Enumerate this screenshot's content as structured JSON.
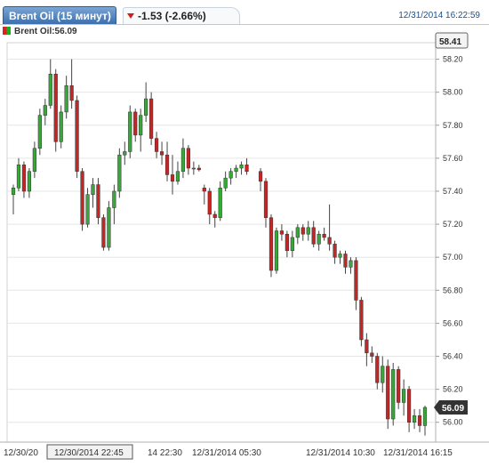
{
  "tab": {
    "title": "Brent Oil (15 минут)"
  },
  "change": {
    "text": "-1.53 (-2.66%)",
    "direction": "down"
  },
  "datetime": "12/31/2014 16:22:59",
  "legend": {
    "label": "Brent Oil:56.09"
  },
  "price_tags": {
    "top": "58.41",
    "last": "56.09"
  },
  "colors": {
    "up": "#33aa33",
    "down": "#cc2222",
    "grid": "#e6e6e6",
    "accent": "#3c6fad"
  },
  "chart_data": {
    "type": "candlestick",
    "title": "Brent Oil (15 минут)",
    "ylim": [
      55.88,
      58.3
    ],
    "y_ticks": [
      "58.20",
      "58.00",
      "57.80",
      "57.60",
      "57.40",
      "57.20",
      "57.00",
      "56.80",
      "56.60",
      "56.40",
      "56.20",
      "56.00"
    ],
    "x_ticks": [
      "12/30/20",
      "12/30/2014 22:45",
      "14 22:30",
      "12/31/2014 05:30",
      "12/31/2014 10:30",
      "12/31/2014 16:15"
    ],
    "x_ticks_highlighted": [
      1
    ],
    "gap_after_index": 44,
    "candles": [
      [
        57.38,
        57.44,
        57.26,
        57.42
      ],
      [
        57.42,
        57.6,
        57.4,
        57.56
      ],
      [
        57.56,
        57.58,
        57.36,
        57.4
      ],
      [
        57.4,
        57.54,
        57.36,
        57.52
      ],
      [
        57.52,
        57.7,
        57.48,
        57.66
      ],
      [
        57.66,
        57.9,
        57.62,
        57.86
      ],
      [
        57.86,
        57.96,
        57.8,
        57.92
      ],
      [
        57.92,
        58.2,
        57.9,
        58.11
      ],
      [
        58.11,
        58.14,
        57.64,
        57.7
      ],
      [
        57.7,
        57.92,
        57.66,
        57.88
      ],
      [
        57.88,
        58.1,
        57.84,
        58.04
      ],
      [
        58.04,
        58.2,
        57.9,
        57.95
      ],
      [
        57.95,
        57.98,
        57.48,
        57.52
      ],
      [
        57.52,
        57.54,
        57.16,
        57.2
      ],
      [
        57.2,
        57.42,
        57.18,
        57.38
      ],
      [
        57.38,
        57.48,
        57.3,
        57.44
      ],
      [
        57.44,
        57.48,
        57.2,
        57.24
      ],
      [
        57.24,
        57.26,
        57.04,
        57.06
      ],
      [
        57.06,
        57.34,
        57.04,
        57.3
      ],
      [
        57.3,
        57.44,
        57.2,
        57.4
      ],
      [
        57.4,
        57.66,
        57.36,
        57.62
      ],
      [
        57.62,
        57.7,
        57.56,
        57.64
      ],
      [
        57.64,
        57.92,
        57.6,
        57.88
      ],
      [
        57.88,
        57.9,
        57.7,
        57.74
      ],
      [
        57.74,
        57.9,
        57.64,
        57.86
      ],
      [
        57.86,
        58.06,
        57.82,
        57.96
      ],
      [
        57.96,
        58.0,
        57.68,
        57.72
      ],
      [
        57.72,
        57.76,
        57.6,
        57.64
      ],
      [
        57.64,
        57.7,
        57.56,
        57.62
      ],
      [
        57.62,
        57.7,
        57.46,
        57.5
      ],
      [
        57.5,
        57.62,
        57.38,
        57.46
      ],
      [
        57.46,
        57.58,
        57.44,
        57.52
      ],
      [
        57.52,
        57.72,
        57.48,
        57.66
      ],
      [
        57.66,
        57.68,
        57.5,
        57.54
      ],
      [
        57.54,
        57.58,
        57.5,
        57.54
      ],
      [
        57.54,
        57.56,
        57.52,
        57.53
      ],
      [
        57.42,
        57.44,
        57.32,
        57.4
      ],
      [
        57.4,
        57.42,
        57.2,
        57.26
      ],
      [
        57.26,
        57.28,
        57.18,
        57.24
      ],
      [
        57.24,
        57.46,
        57.22,
        57.42
      ],
      [
        57.42,
        57.52,
        57.4,
        57.48
      ],
      [
        57.48,
        57.54,
        57.44,
        57.52
      ],
      [
        57.52,
        57.56,
        57.48,
        57.54
      ],
      [
        57.54,
        57.58,
        57.5,
        57.56
      ],
      [
        57.56,
        57.6,
        57.5,
        57.52
      ],
      [
        57.52,
        57.54,
        57.4,
        57.46
      ],
      [
        57.46,
        57.48,
        57.18,
        57.24
      ],
      [
        57.24,
        57.26,
        56.88,
        56.92
      ],
      [
        56.92,
        57.18,
        56.9,
        57.16
      ],
      [
        57.16,
        57.2,
        57.1,
        57.14
      ],
      [
        57.14,
        57.16,
        57.0,
        57.04
      ],
      [
        57.04,
        57.16,
        57.0,
        57.12
      ],
      [
        57.12,
        57.2,
        57.08,
        57.18
      ],
      [
        57.18,
        57.2,
        57.1,
        57.14
      ],
      [
        57.14,
        57.22,
        57.1,
        57.18
      ],
      [
        57.18,
        57.22,
        57.06,
        57.08
      ],
      [
        57.08,
        57.16,
        57.04,
        57.14
      ],
      [
        57.14,
        57.18,
        57.1,
        57.12
      ],
      [
        57.12,
        57.32,
        57.04,
        57.08
      ],
      [
        57.08,
        57.1,
        56.96,
        57.0
      ],
      [
        57.0,
        57.04,
        56.96,
        57.02
      ],
      [
        57.02,
        57.04,
        56.9,
        56.94
      ],
      [
        56.94,
        57.0,
        56.9,
        56.98
      ],
      [
        56.98,
        57.0,
        56.68,
        56.74
      ],
      [
        56.74,
        56.76,
        56.46,
        56.5
      ],
      [
        56.5,
        56.54,
        56.34,
        56.42
      ],
      [
        56.42,
        56.46,
        56.36,
        56.4
      ],
      [
        56.4,
        56.42,
        56.2,
        56.24
      ],
      [
        56.24,
        56.4,
        56.18,
        56.34
      ],
      [
        56.34,
        56.38,
        55.96,
        56.02
      ],
      [
        56.02,
        56.36,
        55.98,
        56.32
      ],
      [
        56.32,
        56.34,
        56.08,
        56.12
      ],
      [
        56.12,
        56.26,
        56.04,
        56.2
      ],
      [
        56.2,
        56.22,
        55.94,
        56.0
      ],
      [
        56.0,
        56.08,
        55.96,
        56.04
      ],
      [
        56.04,
        56.08,
        55.94,
        55.98
      ],
      [
        55.98,
        56.1,
        55.92,
        56.09
      ]
    ]
  }
}
